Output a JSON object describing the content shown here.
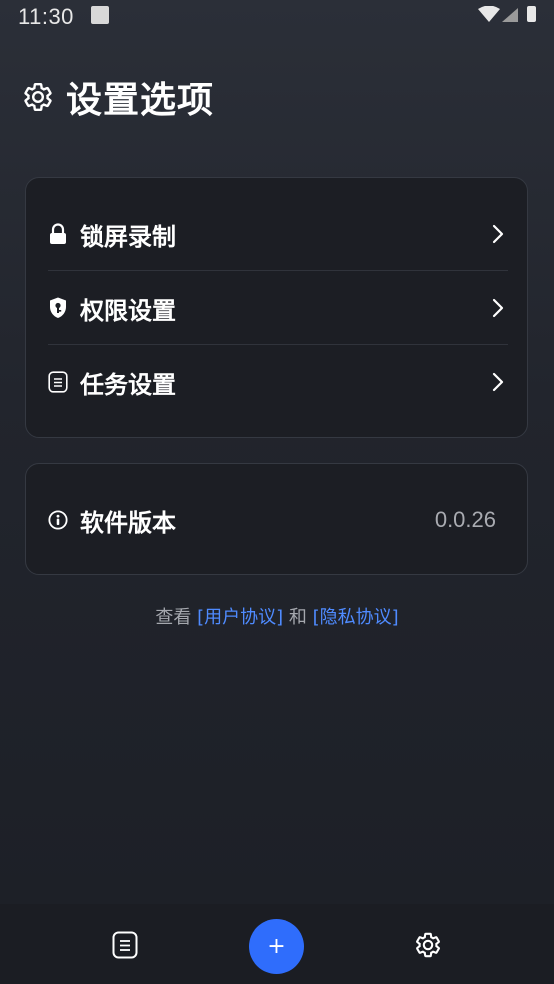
{
  "status_bar": {
    "time": "11:30"
  },
  "header": {
    "title": "设置选项",
    "icon": "gear-icon"
  },
  "settings_card": {
    "items": [
      {
        "label": "锁屏录制",
        "icon": "lock-icon"
      },
      {
        "label": "权限设置",
        "icon": "shield-key-icon"
      },
      {
        "label": "任务设置",
        "icon": "task-list-icon"
      }
    ]
  },
  "version_card": {
    "label": "软件版本",
    "icon": "info-icon",
    "value": "0.0.26"
  },
  "agreements": {
    "prefix": "查看 ",
    "user_agreement": "[用户协议]",
    "conjunction": " 和 ",
    "privacy_agreement": "[隐私协议]"
  },
  "bottom_nav": {
    "add_label": "+",
    "items": [
      "task-list-icon",
      "add-icon",
      "gear-icon"
    ]
  },
  "colors": {
    "accent": "#2f6dfc",
    "link": "#4f8bff",
    "card_bg": "#1c1e24",
    "page_bg": "#22252d"
  }
}
